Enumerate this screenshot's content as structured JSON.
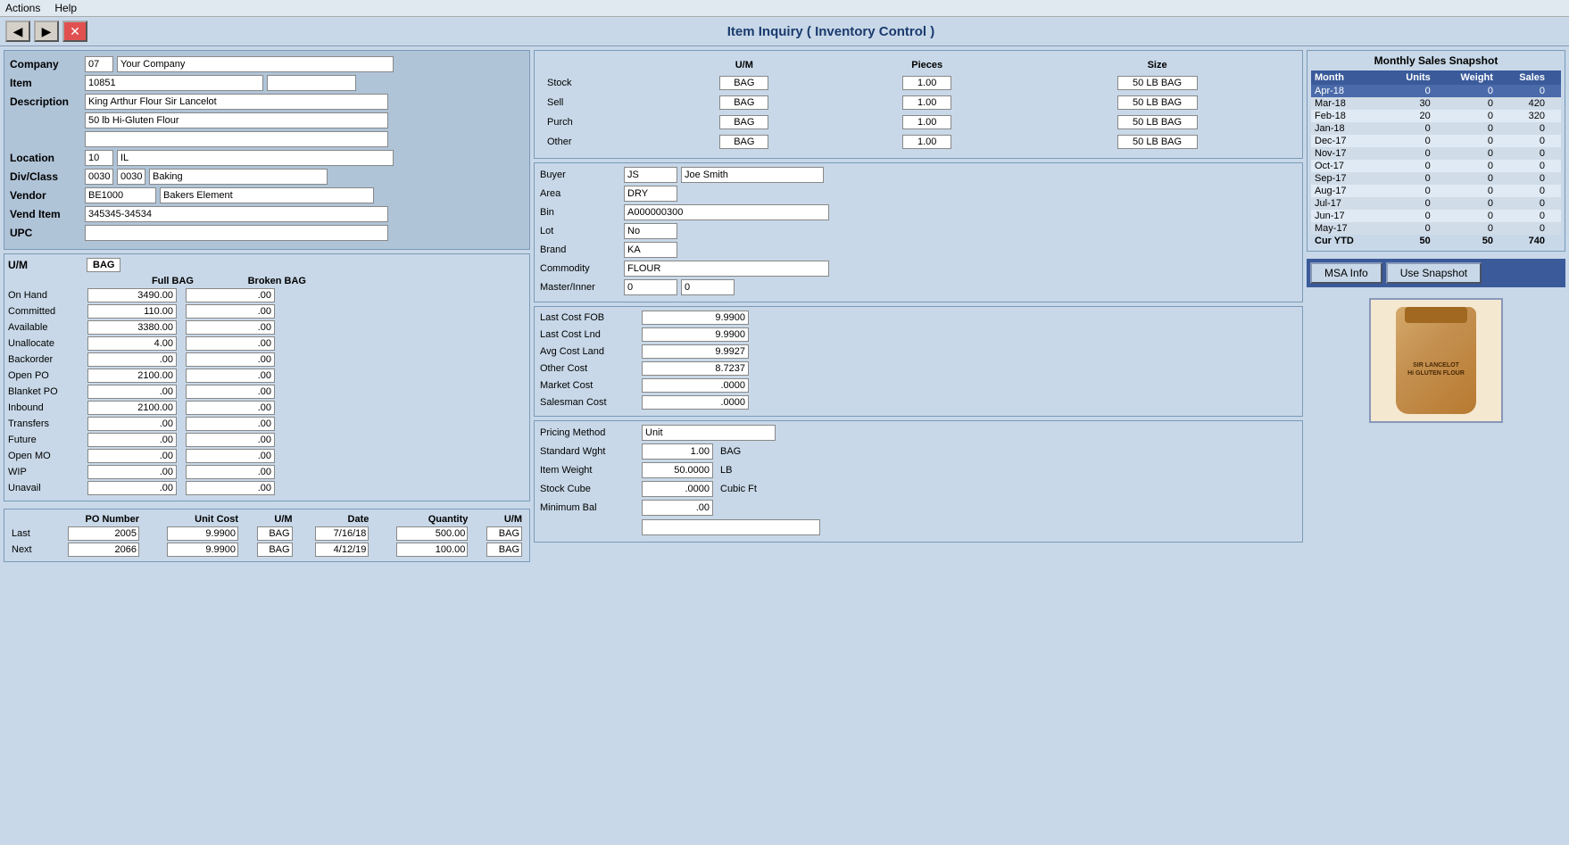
{
  "app": {
    "title": "Item Inquiry ( Inventory Control )",
    "menu": [
      "Actions",
      "Help"
    ]
  },
  "nav": {
    "back_label": "◀",
    "forward_label": "▶",
    "close_label": "✕"
  },
  "company": {
    "label": "Company",
    "code": "07",
    "name": "Your Company"
  },
  "item": {
    "label": "Item",
    "code": "10851",
    "extra": ""
  },
  "description": {
    "label": "Description",
    "line1": "King Arthur Flour Sir Lancelot",
    "line2": "50 lb Hi-Gluten Flour",
    "line3": ""
  },
  "location": {
    "label": "Location",
    "code": "10",
    "name": "IL"
  },
  "div_class": {
    "label": "Div/Class",
    "code1": "0030",
    "code2": "0030",
    "name": "Baking"
  },
  "vendor": {
    "label": "Vendor",
    "code": "BE1000",
    "name": "Bakers Element"
  },
  "vend_item": {
    "label": "Vend Item",
    "value": "345345-34534"
  },
  "upc": {
    "label": "UPC",
    "value": ""
  },
  "uom": {
    "label": "U/M",
    "badge": "BAG",
    "col_full": "Full BAG",
    "col_broken": "Broken BAG",
    "rows": [
      {
        "label": "On Hand",
        "full": "3490.00",
        "broken": ".00"
      },
      {
        "label": "Committed",
        "full": "110.00",
        "broken": ".00"
      },
      {
        "label": "Available",
        "full": "3380.00",
        "broken": ".00"
      },
      {
        "label": "Unallocate",
        "full": "4.00",
        "broken": ".00"
      },
      {
        "label": "Backorder",
        "full": ".00",
        "broken": ".00"
      },
      {
        "label": "Open PO",
        "full": "2100.00",
        "broken": ".00"
      },
      {
        "label": "Blanket PO",
        "full": ".00",
        "broken": ".00"
      },
      {
        "label": "Inbound",
        "full": "2100.00",
        "broken": ".00"
      },
      {
        "label": "Transfers",
        "full": ".00",
        "broken": ".00"
      },
      {
        "label": "Future",
        "full": ".00",
        "broken": ".00"
      },
      {
        "label": "Open MO",
        "full": ".00",
        "broken": ".00"
      },
      {
        "label": "WIP",
        "full": ".00",
        "broken": ".00"
      },
      {
        "label": "Unavail",
        "full": ".00",
        "broken": ".00"
      }
    ]
  },
  "po_table": {
    "headers": [
      "PO Number",
      "Unit Cost",
      "U/M",
      "Date",
      "Quantity",
      "U/M"
    ],
    "last_label": "Last",
    "next_label": "Next",
    "last_row": {
      "po": "2005",
      "cost": "9.9900",
      "uom": "BAG",
      "date": "7/16/18",
      "qty": "500.00",
      "uom2": "BAG"
    },
    "next_row": {
      "po": "2066",
      "cost": "9.9900",
      "uom": "BAG",
      "date": "4/12/19",
      "qty": "100.00",
      "uom2": "BAG"
    }
  },
  "uom_grid": {
    "col_uom": "U/M",
    "col_pieces": "Pieces",
    "col_size": "Size",
    "rows": [
      {
        "label": "Stock",
        "uom": "BAG",
        "pieces": "1.00",
        "size": "50 LB BAG"
      },
      {
        "label": "Sell",
        "uom": "BAG",
        "pieces": "1.00",
        "size": "50 LB BAG"
      },
      {
        "label": "Purch",
        "uom": "BAG",
        "pieces": "1.00",
        "size": "50 LB BAG"
      },
      {
        "label": "Other",
        "uom": "BAG",
        "pieces": "1.00",
        "size": "50 LB BAG"
      }
    ]
  },
  "buyer_info": {
    "buyer_label": "Buyer",
    "buyer_code": "JS",
    "buyer_name": "Joe Smith",
    "area_label": "Area",
    "area_value": "DRY",
    "bin_label": "Bin",
    "bin_value": "A000000300",
    "lot_label": "Lot",
    "lot_value": "No",
    "brand_label": "Brand",
    "brand_value": "KA",
    "commodity_label": "Commodity",
    "commodity_value": "FLOUR",
    "master_label": "Master/Inner",
    "master_val1": "0",
    "master_val2": "0"
  },
  "costs": {
    "last_cost_fob_label": "Last Cost FOB",
    "last_cost_fob": "9.9900",
    "last_cost_lnd_label": "Last Cost Lnd",
    "last_cost_lnd": "9.9900",
    "avg_cost_land_label": "Avg Cost Land",
    "avg_cost_land": "9.9927",
    "other_cost_label": "Other Cost",
    "other_cost": "8.7237",
    "market_cost_label": "Market Cost",
    "market_cost": ".0000",
    "salesman_cost_label": "Salesman Cost",
    "salesman_cost": ".0000"
  },
  "pricing": {
    "method_label": "Pricing Method",
    "method_value": "Unit",
    "std_wght_label": "Standard Wght",
    "std_wght_val": "1.00",
    "std_wght_uom": "BAG",
    "item_weight_label": "Item Weight",
    "item_weight_val": "50.0000",
    "item_weight_uom": "LB",
    "stock_cube_label": "Stock Cube",
    "stock_cube_val": ".0000",
    "stock_cube_uom": "Cubic Ft",
    "min_bal_label": "Minimum Bal",
    "min_bal_val": ".00",
    "extra_field": ""
  },
  "snapshot": {
    "title": "Monthly Sales Snapshot",
    "col_month": "Month",
    "col_units": "Units",
    "col_weight": "Weight",
    "col_sales": "Sales",
    "rows": [
      {
        "month": "Apr-18",
        "units": "0",
        "weight": "0",
        "sales": "0",
        "highlight": true
      },
      {
        "month": "Mar-18",
        "units": "30",
        "weight": "0",
        "sales": "420"
      },
      {
        "month": "Feb-18",
        "units": "20",
        "weight": "0",
        "sales": "320"
      },
      {
        "month": "Jan-18",
        "units": "0",
        "weight": "0",
        "sales": "0"
      },
      {
        "month": "Dec-17",
        "units": "0",
        "weight": "0",
        "sales": "0"
      },
      {
        "month": "Nov-17",
        "units": "0",
        "weight": "0",
        "sales": "0"
      },
      {
        "month": "Oct-17",
        "units": "0",
        "weight": "0",
        "sales": "0"
      },
      {
        "month": "Sep-17",
        "units": "0",
        "weight": "0",
        "sales": "0"
      },
      {
        "month": "Aug-17",
        "units": "0",
        "weight": "0",
        "sales": "0"
      },
      {
        "month": "Jul-17",
        "units": "0",
        "weight": "0",
        "sales": "0"
      },
      {
        "month": "Jun-17",
        "units": "0",
        "weight": "0",
        "sales": "0"
      },
      {
        "month": "May-17",
        "units": "0",
        "weight": "0",
        "sales": "0"
      }
    ],
    "cur_ytd_label": "Cur YTD",
    "cur_ytd_units": "50",
    "cur_ytd_weight": "50",
    "cur_ytd_sales": "740"
  },
  "buttons": {
    "msa_info": "MSA Info",
    "use_snapshot": "Use Snapshot"
  },
  "product": {
    "line1": "SIR LANCELOT",
    "line2": "Hi GLUTEN FLOUR"
  }
}
